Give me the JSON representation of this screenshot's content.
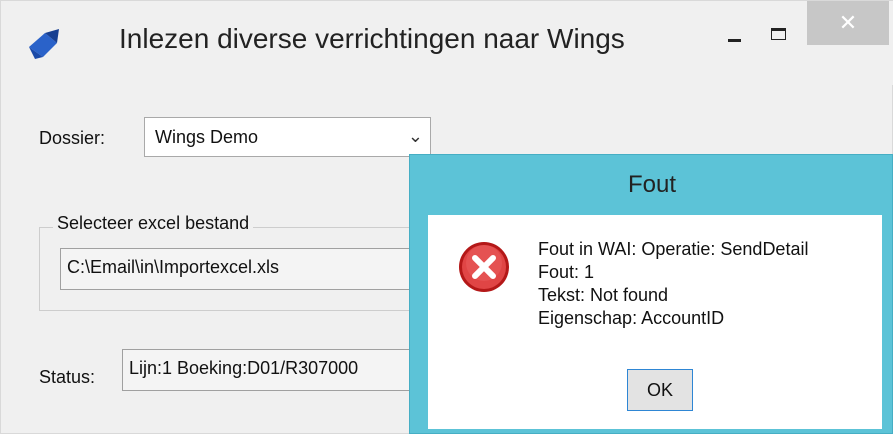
{
  "window": {
    "title": "Inlezen diverse verrichtingen naar Wings",
    "close_glyph": "✕",
    "icons": [
      "app-icon",
      "minimize-icon",
      "maximize-icon",
      "close-icon"
    ]
  },
  "form": {
    "dossier_label": "Dossier:",
    "dossier_value": "Wings Demo",
    "dropdown_glyph": "⌄",
    "group_title": "Selecteer excel bestand",
    "file_path": "C:\\Email\\in\\Importexcel.xls",
    "status_label": "Status:",
    "status_value": "Lijn:1 Boeking:D01/R307000"
  },
  "dialog": {
    "title": "Fout",
    "icon": "error-icon",
    "lines": [
      "Fout in WAI: Operatie: SendDetail",
      "Fout: 1",
      "Tekst: Not found",
      "Eigenschap: AccountID"
    ],
    "ok_label": "OK"
  },
  "colors": {
    "dialog_frame": "#5cc3d7",
    "error_red": "#d32626",
    "close_button": "#c7c7c7"
  }
}
